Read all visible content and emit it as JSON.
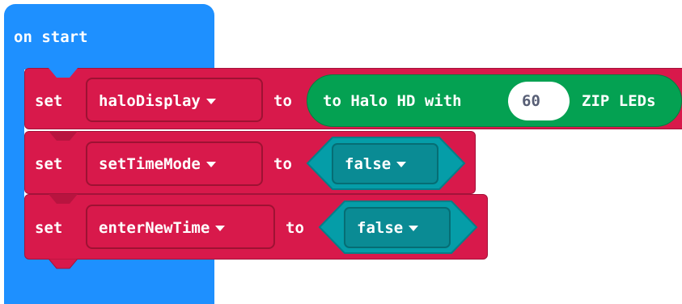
{
  "event_block": {
    "label": "on start"
  },
  "statements": [
    {
      "keyword": "set",
      "variable": "haloDisplay",
      "to_label": "to",
      "value_block": {
        "prefix": "to Halo HD with",
        "number": "60",
        "suffix": "ZIP LEDs"
      }
    },
    {
      "keyword": "set",
      "variable": "setTimeMode",
      "to_label": "to",
      "value_block": {
        "boolean": "false"
      }
    },
    {
      "keyword": "set",
      "variable": "enterNewTime",
      "to_label": "to",
      "value_block": {
        "boolean": "false"
      }
    }
  ],
  "colors": {
    "event_block": "#1e90ff",
    "variable_block": "#d8194b",
    "variable_dropdown_border": "#9e1233",
    "neopixel_block": "#04a152",
    "logic_block": "#059da8",
    "logic_dropdown_fill": "#0a8b94",
    "logic_dropdown_border": "#066d74"
  },
  "icons": [
    "dropdown-caret-icon"
  ]
}
